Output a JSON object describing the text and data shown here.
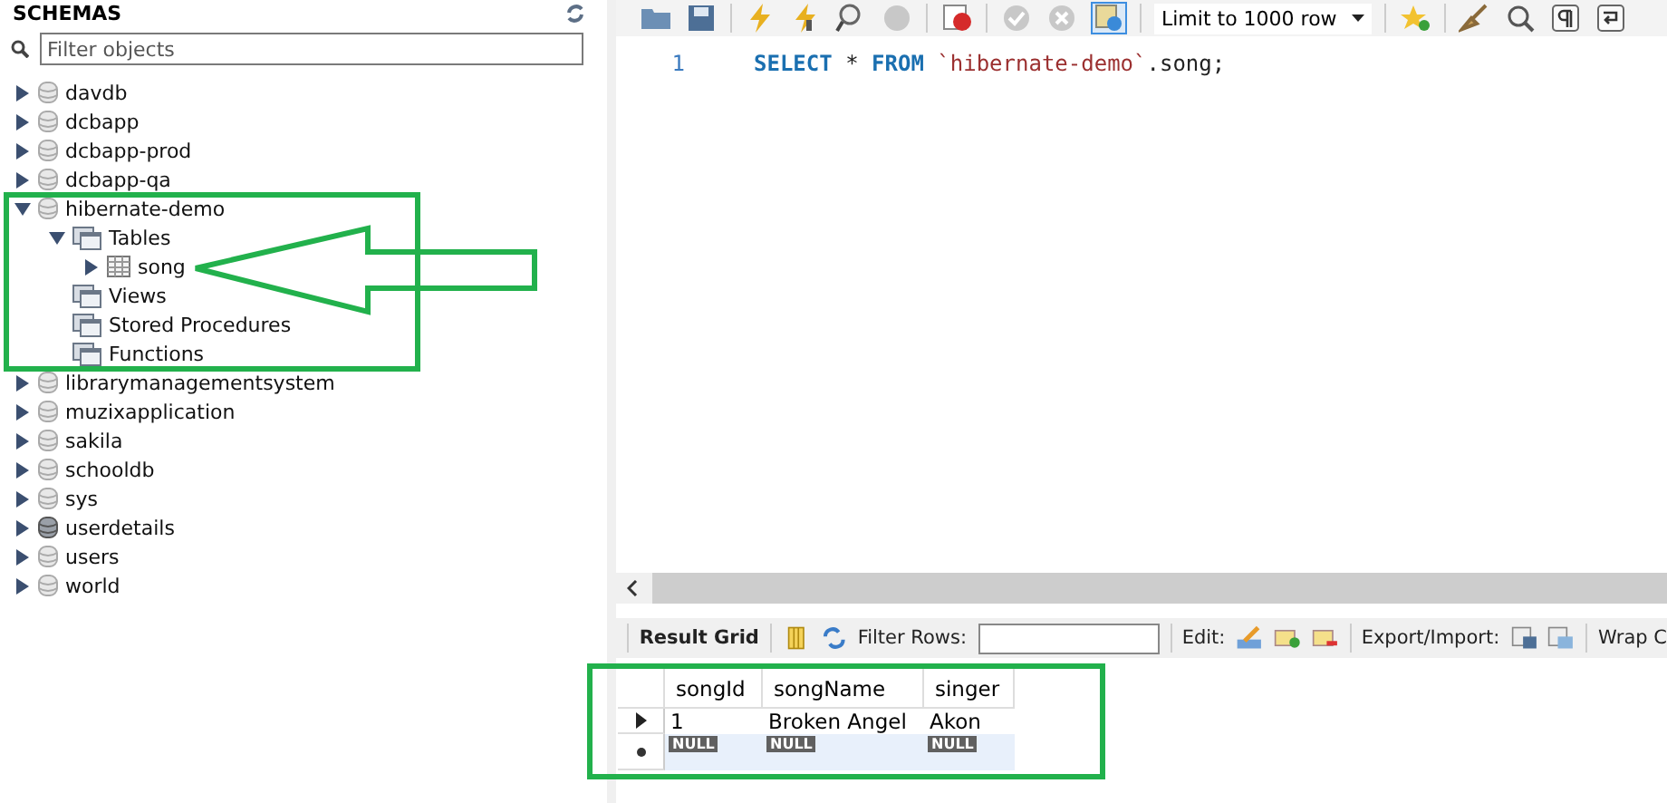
{
  "sidebar": {
    "title": "SCHEMAS",
    "filter": {
      "placeholder": "Filter objects"
    },
    "items": [
      {
        "kind": "schema",
        "label": "davdb",
        "expanded": false,
        "active": false
      },
      {
        "kind": "schema",
        "label": "dcbapp",
        "expanded": false,
        "active": false
      },
      {
        "kind": "schema",
        "label": "dcbapp-prod",
        "expanded": false,
        "active": false
      },
      {
        "kind": "schema",
        "label": "dcbapp-qa",
        "expanded": false,
        "active": false
      },
      {
        "kind": "schema",
        "label": "hibernate-demo",
        "expanded": true,
        "active": false,
        "children": [
          {
            "kind": "folder",
            "label": "Tables",
            "expanded": true,
            "children": [
              {
                "kind": "table",
                "label": "song",
                "expanded": false
              }
            ]
          },
          {
            "kind": "folder",
            "label": "Views"
          },
          {
            "kind": "folder",
            "label": "Stored Procedures"
          },
          {
            "kind": "folder",
            "label": "Functions"
          }
        ]
      },
      {
        "kind": "schema",
        "label": "librarymanagementsystem",
        "expanded": false,
        "active": false
      },
      {
        "kind": "schema",
        "label": "muzixapplication",
        "expanded": false,
        "active": false
      },
      {
        "kind": "schema",
        "label": "sakila",
        "expanded": false,
        "active": false
      },
      {
        "kind": "schema",
        "label": "schooldb",
        "expanded": false,
        "active": false
      },
      {
        "kind": "schema",
        "label": "sys",
        "expanded": false,
        "active": false
      },
      {
        "kind": "schema",
        "label": "userdetails",
        "expanded": false,
        "active": true
      },
      {
        "kind": "schema",
        "label": "users",
        "expanded": false,
        "active": false
      },
      {
        "kind": "schema",
        "label": "world",
        "expanded": false,
        "active": false
      }
    ]
  },
  "toolbar": {
    "limit": "Limit to 1000 row",
    "autocommit_on": true
  },
  "editor": {
    "lines": [
      {
        "number": "1",
        "tokens": [
          {
            "kind": "keyword",
            "text": "SELECT"
          },
          {
            "kind": "operator",
            "text": "*"
          },
          {
            "kind": "keyword",
            "text": "FROM"
          },
          {
            "kind": "identifier",
            "text": "`hibernate-demo`"
          },
          {
            "kind": "suffix",
            "text": ".song;"
          }
        ]
      }
    ]
  },
  "result_toolbar": {
    "view": "Result Grid",
    "filter_label": "Filter Rows:",
    "edit_label": "Edit:",
    "export_label": "Export/Import:",
    "wrap_label": "Wrap C"
  },
  "result_grid": {
    "columns": [
      "songId",
      "songName",
      "singer"
    ],
    "rows": [
      {
        "kind": "data",
        "current": true,
        "cells": [
          "1",
          "Broken Angel",
          "Akon"
        ]
      },
      {
        "kind": "new",
        "current": false,
        "cells": [
          "NULL",
          "NULL",
          "NULL"
        ]
      }
    ]
  }
}
